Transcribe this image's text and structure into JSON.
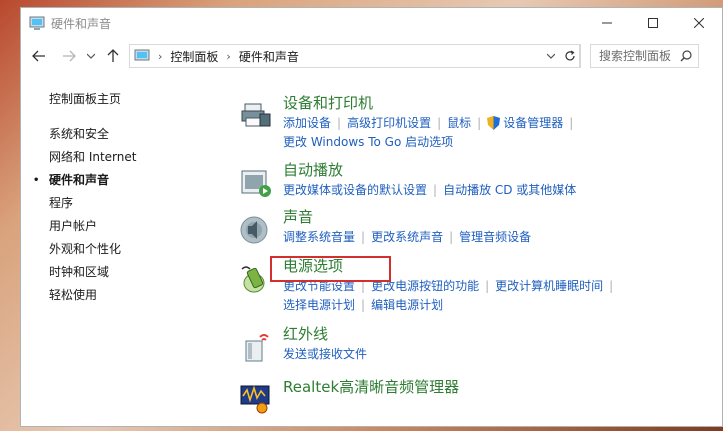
{
  "window": {
    "title": "硬件和声音"
  },
  "address": {
    "crumbs": [
      "控制面板",
      "硬件和声音"
    ],
    "search_placeholder": "搜索控制面板"
  },
  "leftnav": {
    "home": "控制面板主页",
    "items": [
      "系统和安全",
      "网络和 Internet",
      "硬件和声音",
      "程序",
      "用户帐户",
      "外观和个性化",
      "时钟和区域",
      "轻松使用"
    ],
    "active_index": 2
  },
  "categories": {
    "devices": {
      "title": "设备和打印机",
      "links": [
        "添加设备",
        "高级打印机设置",
        "鼠标",
        "设备管理器"
      ],
      "links2": [
        "更改 Windows To Go 启动选项"
      ]
    },
    "autoplay": {
      "title": "自动播放",
      "links": [
        "更改媒体或设备的默认设置",
        "自动播放 CD 或其他媒体"
      ]
    },
    "sound": {
      "title": "声音",
      "links": [
        "调整系统音量",
        "更改系统声音",
        "管理音频设备"
      ]
    },
    "power": {
      "title": "电源选项",
      "links": [
        "更改节能设置",
        "更改电源按钮的功能",
        "更改计算机睡眠时间"
      ],
      "links2": [
        "选择电源计划",
        "编辑电源计划"
      ]
    },
    "infrared": {
      "title": "红外线",
      "links": [
        "发送或接收文件"
      ]
    },
    "realtek": {
      "title": "Realtek高清晰音频管理器"
    }
  },
  "colors": {
    "category_title": "#2e7d32",
    "link": "#1f5fbf",
    "highlight_border": "#d32f2f"
  }
}
